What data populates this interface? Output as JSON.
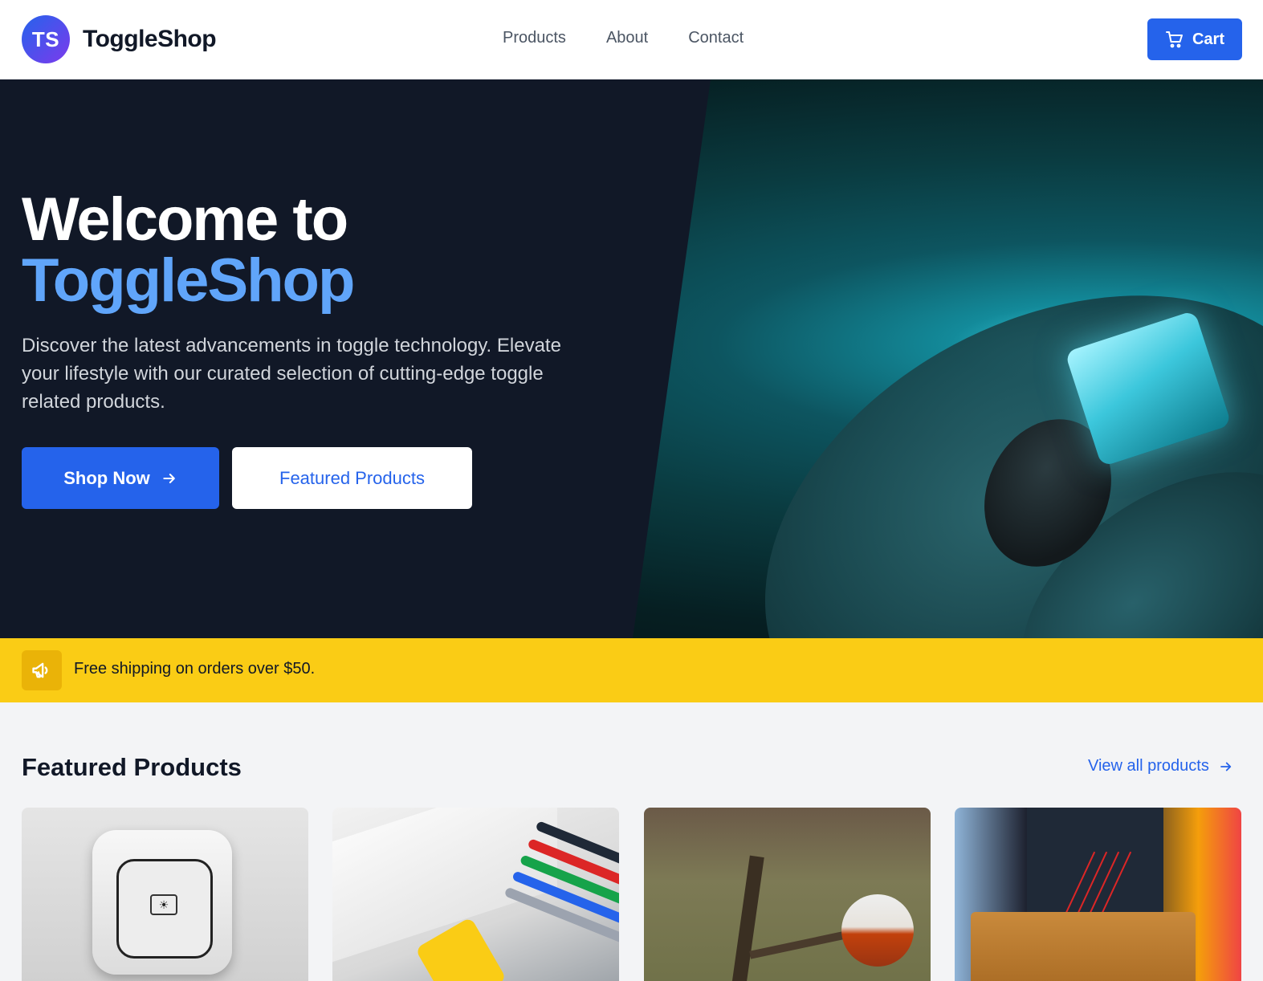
{
  "header": {
    "logo_initials": "TS",
    "brand_name": "ToggleShop",
    "nav": [
      "Products",
      "About",
      "Contact"
    ],
    "cart_label": "Cart"
  },
  "hero": {
    "title_line1": "Welcome to",
    "title_line2": "ToggleShop",
    "description": "Discover the latest advancements in toggle technology. Elevate your lifestyle with our curated selection of cutting-edge toggle related products.",
    "primary_button": "Shop Now",
    "secondary_button": "Featured Products"
  },
  "banner": {
    "icon": "megaphone-icon",
    "text": "Free shipping on orders over $50."
  },
  "featured": {
    "title": "Featured Products",
    "view_all": "View all products"
  },
  "colors": {
    "primary": "#2563eb",
    "hero_bg": "#111827",
    "hero_accent": "#60a5fa",
    "banner_bg": "#facc15",
    "banner_icon_bg": "#eab308",
    "page_bg": "#f3f4f6"
  }
}
